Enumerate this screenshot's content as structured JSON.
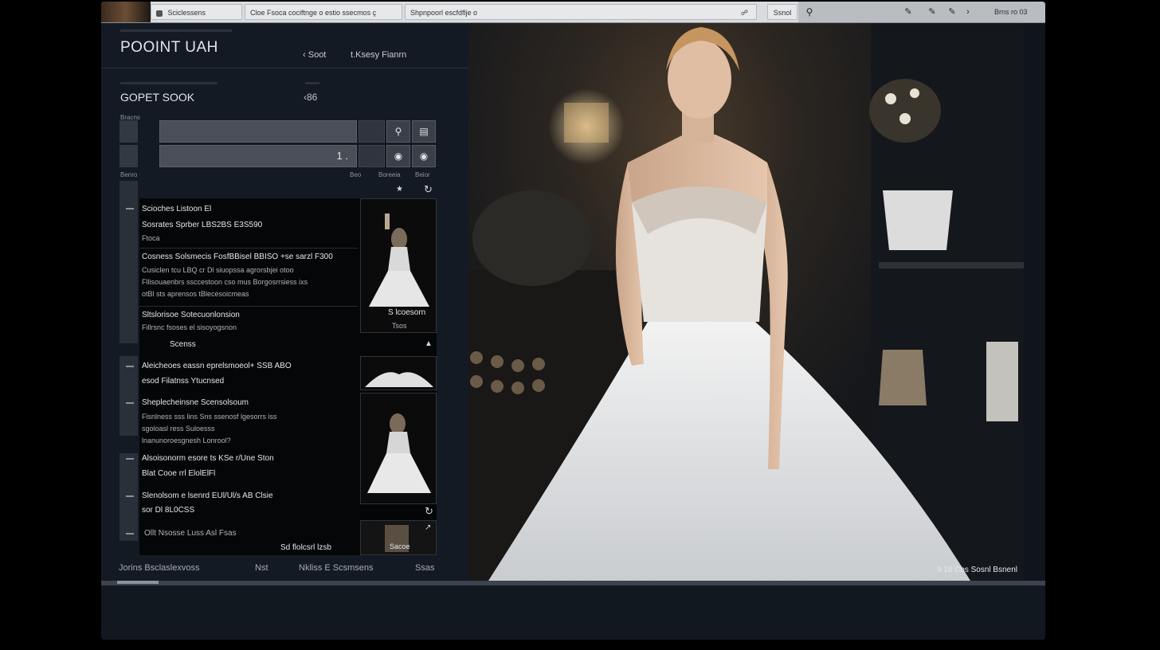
{
  "toolbar": {
    "seg1": "Sciclessens",
    "seg2": "Cloe Fsoca cociftnge o estio ssecmos ç",
    "seg3": "Shpnpoorl escfdflje o",
    "seg4": "Ssnol",
    "right_label": "Brns ro 03"
  },
  "left": {
    "app_title": "POOINT UAH",
    "link_soot": "Soot",
    "link_filter": "t.Ksesy Fianrn",
    "section_title": "GOPET SOOK",
    "section_count": "‹86",
    "label_brand": "Bracns",
    "field2_value": "1 .",
    "label_col": "Benro",
    "label_col2": "Beo",
    "label_col3": "Boreeia",
    "label_col4": "Beior"
  },
  "items": [
    {
      "title": "Scioches Listoon El",
      "line1": "Sosrates Sprber LBS2BS E3S590",
      "line2": "Ftoca"
    },
    {
      "title": "Cosness Solsmecis FosfBBisel BBISO  +se sarzl F300",
      "line1": "Cusiclen tcu LBQ cr Dl siuopssa agrorsbjei otoo",
      "line2": "Fllisouaenbrs ssccestoon cso mus Borgosrrsiess ixs",
      "line3": "otBl sts aprensos tBlecesoicmeas"
    },
    {
      "title": "Sltslorisoe Sotecuonlonsion",
      "line1": "Fillrsnc fsoses el sisoyogsnon"
    },
    {
      "title": "Scenss"
    },
    {
      "title": "Aleicheoes eassn eprelsmoeol+ SSB ABO",
      "line1": "esod Filatnss Ytucnsed"
    },
    {
      "title": "Sheplecheinsne Scensolsoum",
      "line1": "Fisnlness sss lins Sns ssenosf lgesorrs iss",
      "line2": "sgoloasl ress Suloesss",
      "line3": "lnanunoroesgnesh Lonrool?"
    },
    {
      "title": "Alsoisonorm esore ts KSe  r/Une Ston",
      "line1": "Blat Cooe rrl ElolElFl"
    },
    {
      "title": "Slenolsom e lsenrd EUl/Ul/s AB Clsie",
      "line1": "sor Dl 8L0CSS"
    },
    {
      "title": "Ollt Nsosse Luss Asl Fsas"
    }
  ],
  "thumbs": {
    "cap1a": "S lcoesorn",
    "cap1b": "Tsos",
    "cap4": "Sacoe"
  },
  "list_footer_right": "Sd flolcsrl lzsb",
  "footer": {
    "f1": "Jorins Bsclaslexvoss",
    "f2": "Nst",
    "f3": "Nkliss  E Scsmsens",
    "f4": "Ssas"
  },
  "photo": {
    "caption": "9.18 Cbs  Sosnl Bsnenl"
  },
  "colors": {
    "accent": "#e7e8ea",
    "panel": "#141a23"
  }
}
